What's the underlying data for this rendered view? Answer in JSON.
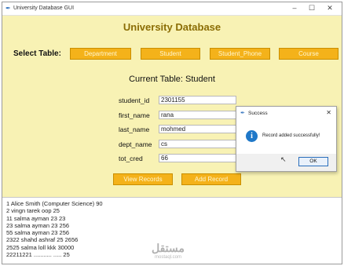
{
  "window": {
    "title": "University Database GUI",
    "controls": {
      "minimize": "–",
      "maximize": "☐",
      "close": "✕"
    }
  },
  "heading": "University Database",
  "table_select": {
    "label": "Select Table:",
    "buttons": [
      "Department",
      "Student",
      "Student_Phone",
      "Course"
    ]
  },
  "current_table": "Current Table: Student",
  "form": {
    "fields": [
      {
        "label": "student_id",
        "value": "2301155"
      },
      {
        "label": "first_name",
        "value": "rana"
      },
      {
        "label": "last_name",
        "value": "mohmed"
      },
      {
        "label": "dept_name",
        "value": "cs"
      },
      {
        "label": "tot_cred",
        "value": "66"
      }
    ]
  },
  "actions": {
    "view": "View Records",
    "add": "Add Record"
  },
  "output": {
    "lines": [
      "1 Alice Smith (Computer Science) 90",
      "2 vingn tarek oop 25",
      "11 salma ayman 23 23",
      "23 salma ayman 23 256",
      "55 salma ayman 23 256",
      "2322 shahd ashraf 25 2656",
      "2525 salma loll kkk 30000",
      "22211221 ........... ..... 25"
    ]
  },
  "dialog": {
    "title": "Success",
    "message": "Record added successfully!",
    "ok_label": "OK",
    "close": "✕"
  },
  "watermark": {
    "brand": "مستقل",
    "url": "mostaql.com"
  },
  "colors": {
    "background": "#f8f2b4",
    "button": "#f4b21a",
    "heading": "#8b6d05",
    "info": "#1f78c8"
  }
}
